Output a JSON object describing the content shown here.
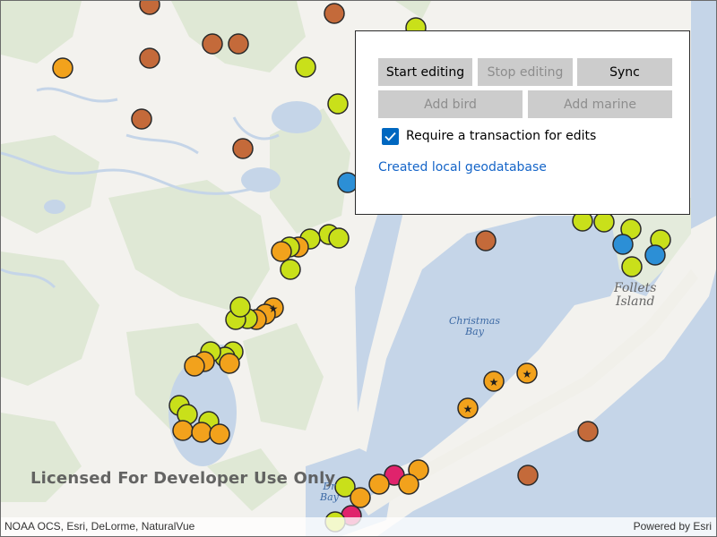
{
  "panel": {
    "start_editing": "Start editing",
    "stop_editing": "Stop editing",
    "sync": "Sync",
    "add_bird": "Add bird",
    "add_marine": "Add marine",
    "require_transaction": "Require a transaction for edits",
    "require_transaction_checked": true,
    "status": "Created local geodatabase"
  },
  "map": {
    "watermark": "Licensed For Developer Use Only",
    "attribution": "NOAA OCS, Esri, DeLorme, NaturalVue",
    "powered_by": "Powered by Esri",
    "labels": {
      "christmas_bay": "Christmas\nBay",
      "follets_island": "Follets\nIsland",
      "drum_bay": "Dr\nBay"
    }
  },
  "colors": {
    "water": "#c5d5e8",
    "land": "#f3f2ee",
    "marsh": "#dde6d3",
    "bird": "#c9e01a",
    "marine_orange": "#f2a21c",
    "marine_brown": "#c46a3a",
    "fish_blue": "#2c8fd6",
    "crab_pink": "#e0236c",
    "button": "#cccccc",
    "checkbox": "#0067c0",
    "status_text": "#1565c8"
  },
  "symbols": {
    "bird": [
      "heron",
      "duck"
    ],
    "marine_orange": [
      "seal",
      "duck",
      "starfish",
      "crab",
      "footprints",
      "bird"
    ],
    "marine_brown": [
      "seal",
      "whale-tail",
      "waves",
      "dolphin"
    ],
    "fish_blue": [
      "fish"
    ],
    "crab_pink": [
      "crab"
    ]
  }
}
